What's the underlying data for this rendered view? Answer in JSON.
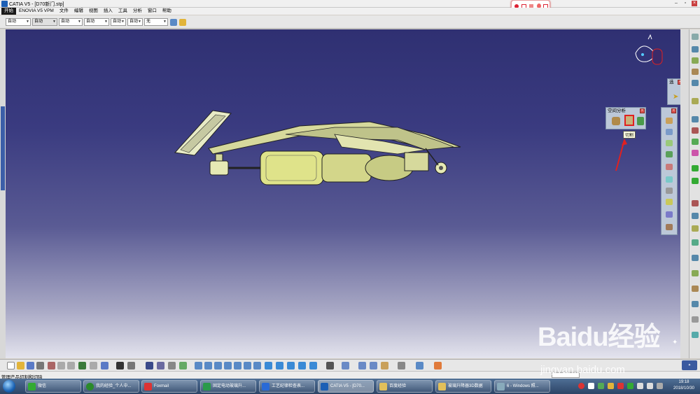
{
  "window": {
    "title": "CATIA V5 - [D70新门.stp]",
    "min": "–",
    "max": "▫",
    "close": "×"
  },
  "menu": {
    "start": "开始",
    "items": [
      "ENOVIA V5 VPM",
      "文件",
      "编辑",
      "视图",
      "插入",
      "工具",
      "分析",
      "窗口",
      "帮助"
    ]
  },
  "props_toolbar": {
    "combos": [
      "自动",
      "自动",
      "自动",
      "自动",
      "自动",
      "自动",
      "无"
    ]
  },
  "analysis_panel": {
    "title": "空间分析",
    "tooltip": "切割"
  },
  "select_panel": {
    "title": "选"
  },
  "status": {
    "text": "管理产品切割和切除"
  },
  "taskbar": {
    "items": [
      "微信",
      "我的经验_个人中...",
      "Foxmail",
      "固定电动玻璃升...",
      "工艺纪律检查表...",
      "CATIA V5 - [D70...",
      "百度经验",
      "玻璃升降器3D数据",
      "6 - Windows 照..."
    ],
    "clock_time": "19:18",
    "clock_date": "2018/10/30"
  },
  "watermark": {
    "logo": "Baidu经验",
    "url": "jingyan.baidu.com"
  },
  "colors": {
    "model": "#d6d99c",
    "viewport_top": "#2f3072",
    "highlight": "#e02020"
  }
}
